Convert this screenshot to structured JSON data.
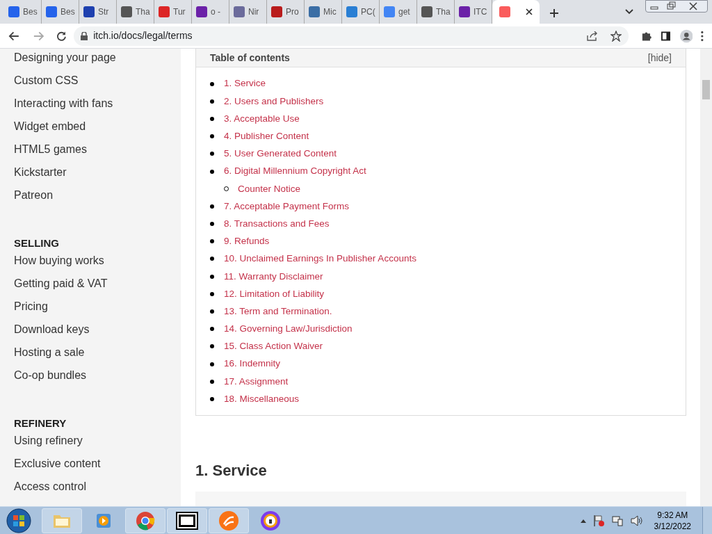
{
  "tabs": [
    {
      "label": "Bes",
      "color": "#2563eb",
      "selected": false
    },
    {
      "label": "Bes",
      "color": "#2563eb",
      "selected": false
    },
    {
      "label": "Str",
      "color": "#1e40af",
      "selected": false
    },
    {
      "label": "Tha",
      "color": "#555555",
      "selected": false
    },
    {
      "label": "Tur",
      "color": "#dc2626",
      "selected": false
    },
    {
      "label": "o -",
      "color": "#6b21a8",
      "selected": false
    },
    {
      "label": "Nir",
      "color": "#6b6b9b",
      "selected": false
    },
    {
      "label": "Pro",
      "color": "#b91c1c",
      "selected": false
    },
    {
      "label": "Mic",
      "color": "#3b6ea5",
      "selected": false
    },
    {
      "label": "PC(",
      "color": "#2a7fd4",
      "selected": false
    },
    {
      "label": "get",
      "color": "#4285f4",
      "selected": false
    },
    {
      "label": "Tha",
      "color": "#555555",
      "selected": false
    },
    {
      "label": "ITC",
      "color": "#6b21a8",
      "selected": false
    },
    {
      "color": "#fa5c5c",
      "selected": true
    }
  ],
  "address": "itch.io/docs/legal/terms",
  "sidebar": {
    "sections": [
      {
        "items": [
          "Designing your page",
          "Custom CSS",
          "Interacting with fans",
          "Widget embed",
          "HTML5 games",
          "Kickstarter",
          "Patreon"
        ]
      },
      {
        "heading": "SELLING",
        "items": [
          "How buying works",
          "Getting paid & VAT",
          "Pricing",
          "Download keys",
          "Hosting a sale",
          "Co-op bundles"
        ]
      },
      {
        "heading": "REFINERY",
        "items": [
          "Using refinery",
          "Exclusive content",
          "Access control"
        ]
      }
    ]
  },
  "toc": {
    "title": "Table of contents",
    "toggle": "[hide]",
    "items": [
      {
        "label": "1. Service"
      },
      {
        "label": "2. Users and Publishers"
      },
      {
        "label": "3. Acceptable Use"
      },
      {
        "label": "4. Publisher Content"
      },
      {
        "label": "5. User Generated Content"
      },
      {
        "label": "6. Digital Millennium Copyright Act",
        "children": [
          {
            "label": "Counter Notice"
          }
        ]
      },
      {
        "label": "7. Acceptable Payment Forms"
      },
      {
        "label": "8. Transactions and Fees"
      },
      {
        "label": "9. Refunds"
      },
      {
        "label": "10. Unclaimed Earnings In Publisher Accounts"
      },
      {
        "label": "11. Warranty Disclaimer"
      },
      {
        "label": "12. Limitation of Liability"
      },
      {
        "label": "13. Term and Termination."
      },
      {
        "label": "14. Governing Law/Jurisdiction"
      },
      {
        "label": "15. Class Action Waiver"
      },
      {
        "label": "16. Indemnity"
      },
      {
        "label": "17. Assignment"
      },
      {
        "label": "18. Miscellaneous"
      }
    ]
  },
  "section_heading": "1. Service",
  "clock": {
    "time": "9:32 AM",
    "date": "3/12/2022"
  }
}
